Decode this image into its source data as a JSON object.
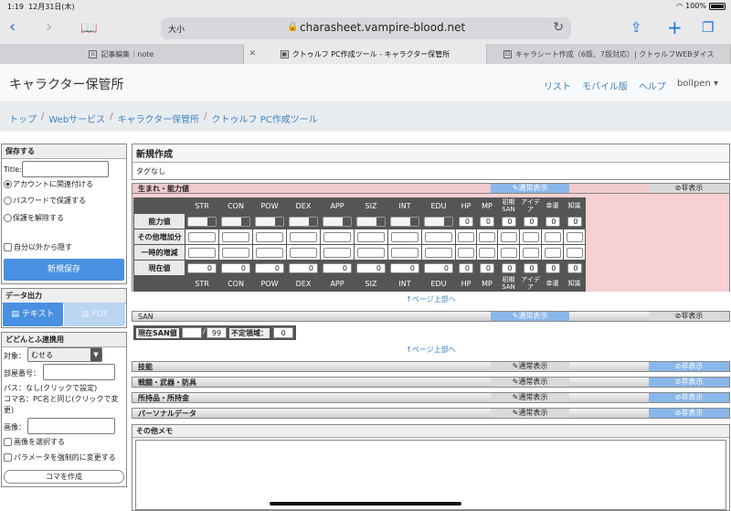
{
  "status": {
    "time": "1:19",
    "date": "12月31日(木)",
    "battery": "100%"
  },
  "browser": {
    "size_label": "大小",
    "url": "charasheet.vampire-blood.net"
  },
  "tabs": [
    {
      "label": "記事編集｜note"
    },
    {
      "label": "クトゥルフ PC作成ツール - キャラクター保管所"
    },
    {
      "label": "キャラシート作成（6版、7版対応）| クトゥルフWEBダイス"
    }
  ],
  "navbar": {
    "brand": "キャラクター保管所",
    "links": [
      "リスト",
      "モバイル版",
      "ヘルプ"
    ],
    "user": "bollpen ▾"
  },
  "breadcrumb": [
    "トップ",
    "Webサービス",
    "キャラクター保管所",
    "クトゥルフ PC作成ツール"
  ],
  "save_panel": {
    "title": "保存する",
    "title_label": "Title:",
    "options": [
      "アカウントに関連付ける",
      "パスワードで保護する",
      "保護を解除する"
    ],
    "hide_label": "自分以外から隠す",
    "save_button": "新規保存"
  },
  "export_panel": {
    "title": "データ出力",
    "text_button": "テキスト",
    "pdf_button": "PDF"
  },
  "dodontof_panel": {
    "title": "どどんとふ連携用",
    "target_label": "対象：",
    "target_value": "むせる",
    "room_label": "部屋番号：",
    "pass_text": "パス：なし(クリックで設定)",
    "koma_text": "コマ名：PC名と同じ(クリックで変更)",
    "image_label": "画像：",
    "select_image": "画像を選択する",
    "force_param": "パラメータを強制的に変更する",
    "create_button": "コマを作成"
  },
  "main": {
    "title": "新規作成",
    "tags": "タグなし",
    "normal_label": "通常表示",
    "hide_label": "非表示",
    "pagetop": "↑ページ上部へ",
    "birth_section": "生まれ・能力値",
    "stat_headers": [
      "STR",
      "CON",
      "POW",
      "DEX",
      "APP",
      "SIZ",
      "INT",
      "EDU",
      "HP",
      "MP",
      "初期SAN",
      "アイデア",
      "幸運",
      "知識"
    ],
    "row_labels": [
      "能力値",
      "その他増加分",
      "一時的増減",
      "現在値"
    ],
    "ability_values": [
      "0",
      "0",
      "0",
      "0",
      "0",
      "0"
    ],
    "current_values": [
      "0",
      "0",
      "0",
      "0",
      "0",
      "0",
      "0",
      "0",
      "0",
      "0",
      "0",
      "0",
      "0",
      "0"
    ],
    "san_section": "SAN",
    "san_current_label": "現在SAN値",
    "san_max": "99",
    "san_indef_label": "不定領域：",
    "san_indef_value": "0",
    "sections": [
      "技能",
      "戦闘・武器・防具",
      "所持品・所持金",
      "パーソナルデータ"
    ],
    "memo_title": "その他メモ"
  }
}
